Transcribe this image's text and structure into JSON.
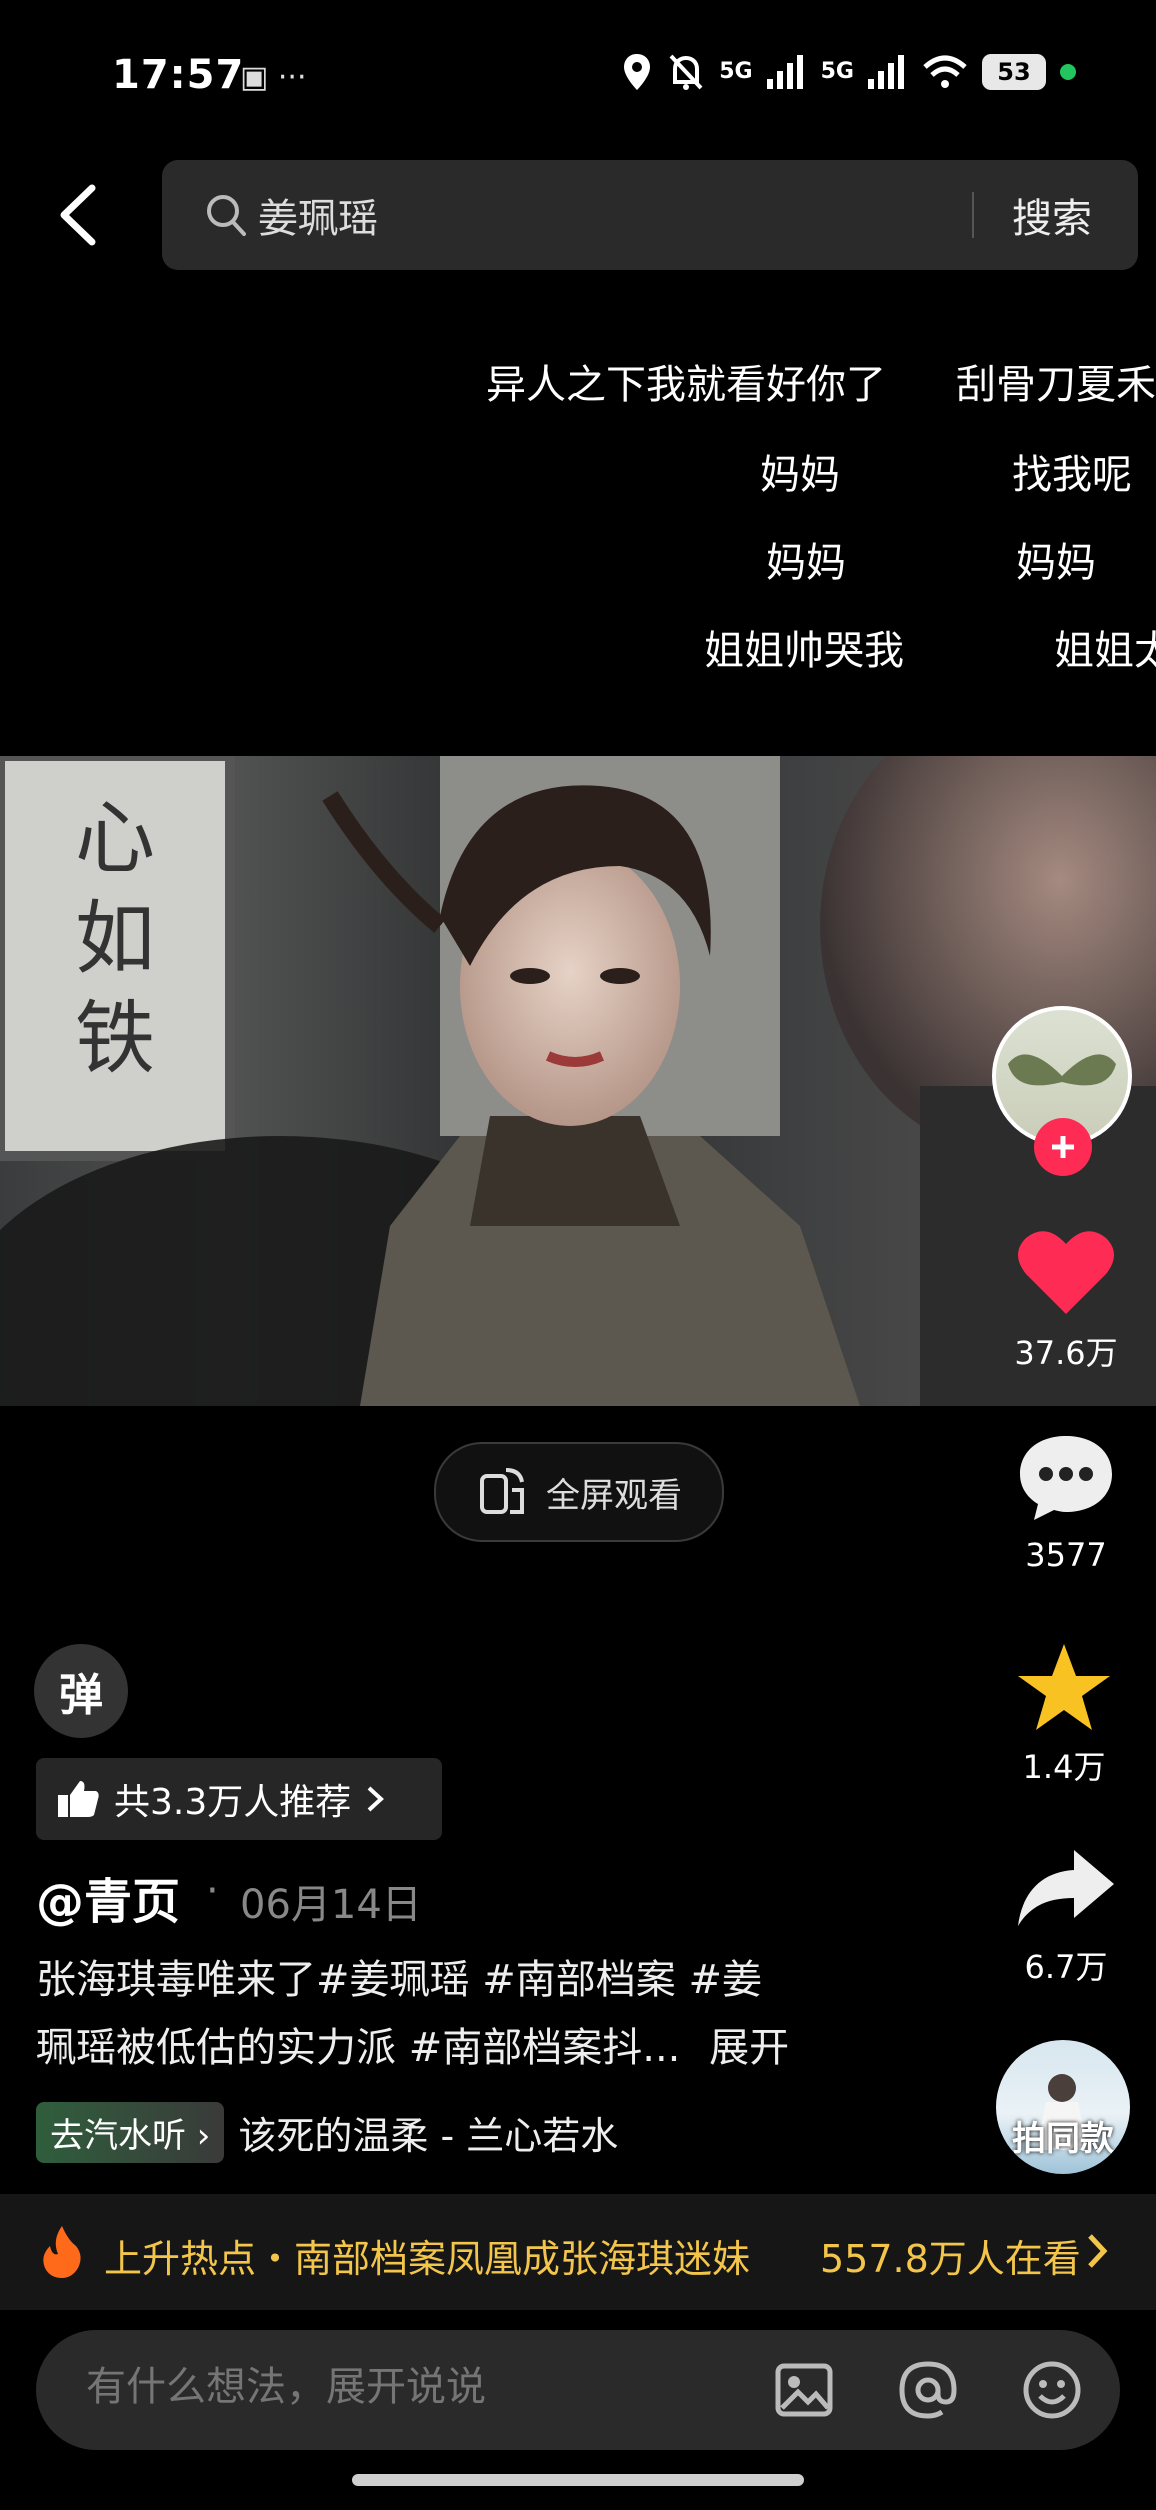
{
  "status_bar": {
    "time": "17:57",
    "left_icons": "▣ ···",
    "signal_1": "5G",
    "signal_2": "5G",
    "battery": "53"
  },
  "search": {
    "query": "姜珮瑶",
    "button_label": "搜索"
  },
  "danmaku": [
    "异人之下我就看好你了",
    "刮骨刀夏禾",
    "妈妈",
    "找我呢",
    "妈妈",
    "妈妈",
    "姐姐帅哭我",
    "姐姐太"
  ],
  "player": {
    "fullscreen_label": "全屏观看"
  },
  "actions": {
    "likes": "37.6万",
    "comments": "3577",
    "favorites": "1.4万",
    "shares": "6.7万",
    "same_style_label": "拍同款"
  },
  "post": {
    "danmaku_toggle": "弹",
    "recommend_text": "共3.3万人推荐",
    "author": "@青页",
    "date": "06月14日",
    "caption_line1": "张海琪毒唯来了#姜珮瑶 #南部档案 #姜",
    "caption_line2": "珮瑶被低估的实力派 #南部档案抖...",
    "expand_label": "展开",
    "listen_chip": "去汽水听",
    "music_title": "该死的温柔 - 兰心若水"
  },
  "hot_bar": {
    "text": "上升热点・南部档案凤凰成张海琪迷妹",
    "viewers": "557.8万人在看"
  },
  "comment": {
    "placeholder": "有什么想法，展开说说"
  },
  "colors": {
    "like_red": "#fe2c55",
    "star_yellow": "#f8c322",
    "hot_gold": "#f3c64b"
  }
}
